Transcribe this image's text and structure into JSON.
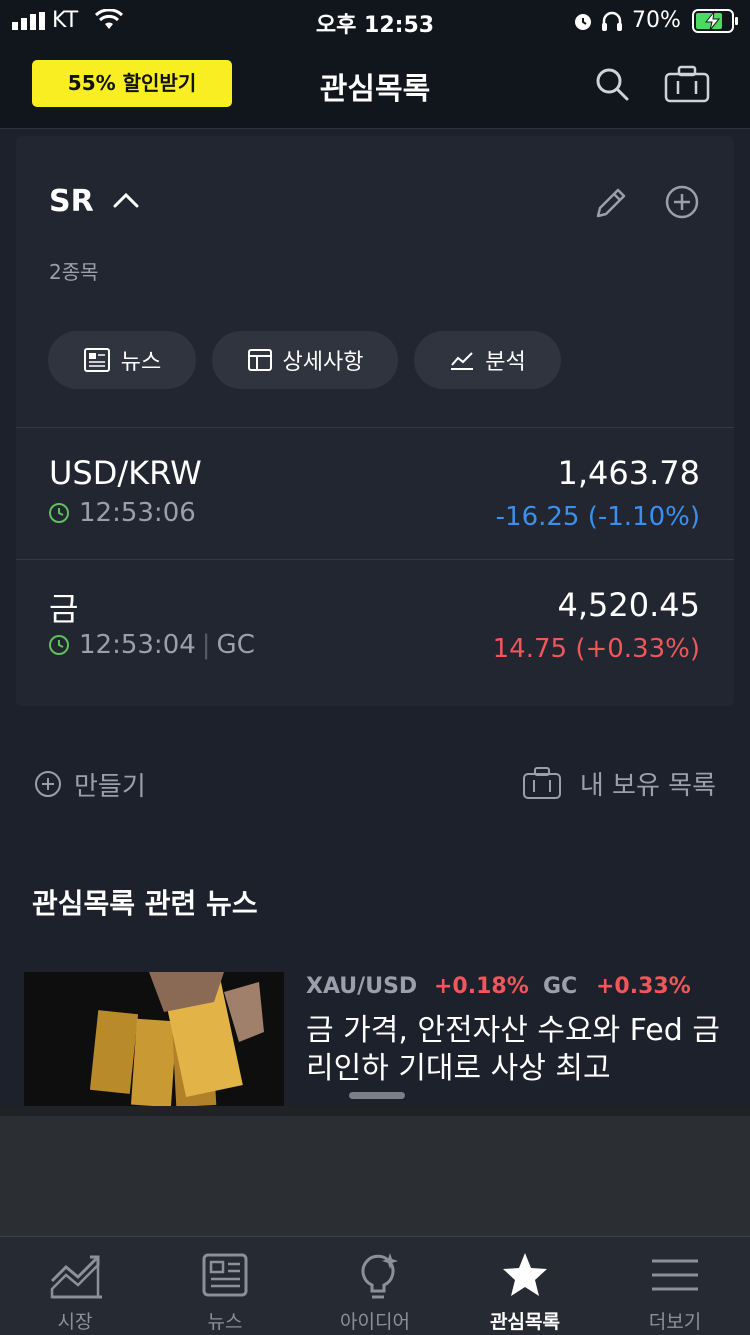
{
  "status": {
    "carrier": "KT",
    "time": "오후 12:53",
    "battery": "70%"
  },
  "header": {
    "promo": "55% 할인받기",
    "title": "관심목록"
  },
  "watchlist": {
    "name": "SR",
    "count": "2종목",
    "pills": [
      {
        "icon": "newspaper-icon",
        "label": "뉴스"
      },
      {
        "icon": "table-icon",
        "label": "상세사항"
      },
      {
        "icon": "chart-icon",
        "label": "분석"
      }
    ],
    "items": [
      {
        "symbol": "USD/KRW",
        "time": "12:53:06",
        "exchange": "",
        "price": "1,463.78",
        "change": "-16.25",
        "change_pct": "(-1.10%)",
        "direction": "down"
      },
      {
        "symbol": "금",
        "time": "12:53:04",
        "exchange": "GC",
        "price": "4,520.45",
        "change": "14.75",
        "change_pct": "(+0.33%)",
        "direction": "up"
      }
    ]
  },
  "actions": {
    "create": "만들기",
    "holdings": "내 보유 목록"
  },
  "news": {
    "section_title": "관심목록 관련 뉴스",
    "tags": [
      {
        "symbol": "XAU/USD",
        "change": "+0.18%"
      },
      {
        "symbol": "GC",
        "change": "+0.33%"
      }
    ],
    "headline": "금 가격, 안전자산 수요와 Fed 금리인하 기대로 사상 최고"
  },
  "tabs": [
    {
      "label": "시장",
      "icon": "market-chart-icon",
      "active": false
    },
    {
      "label": "뉴스",
      "icon": "news-icon",
      "active": false
    },
    {
      "label": "아이디어",
      "icon": "idea-bulb-icon",
      "active": false
    },
    {
      "label": "관심목록",
      "icon": "star-icon",
      "active": true
    },
    {
      "label": "더보기",
      "icon": "menu-icon",
      "active": false
    }
  ],
  "colors": {
    "up": "#f0565a",
    "down": "#3a8fef",
    "promo": "#f8ee22",
    "clock": "#5fc05c"
  }
}
